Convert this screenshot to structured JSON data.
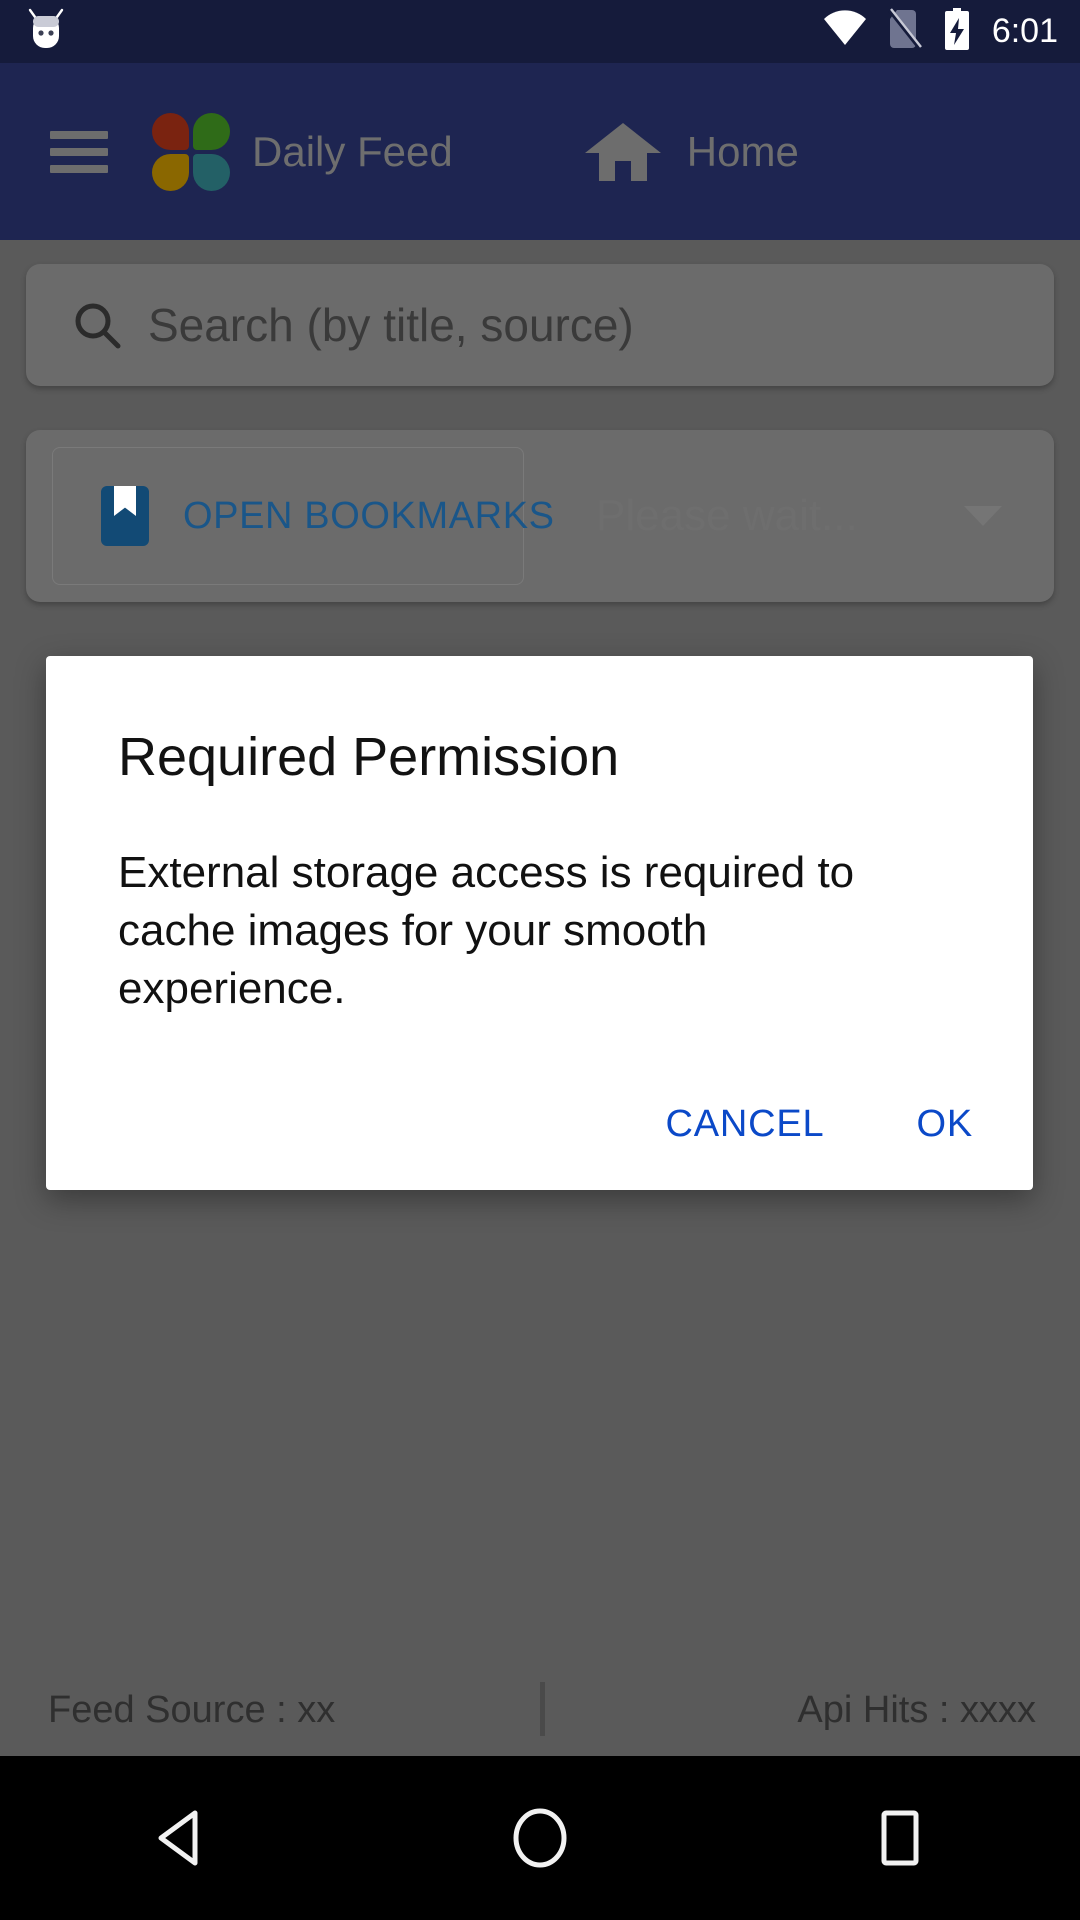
{
  "status_bar": {
    "time": "6:01",
    "icons": [
      "android-head-icon",
      "wifi-icon",
      "no-sim-icon",
      "battery-charging-icon"
    ]
  },
  "app_bar": {
    "menu_icon": "hamburger-menu-icon",
    "logo_icon": "four-petal-logo-icon",
    "title": "Daily Feed",
    "home_icon": "home-icon",
    "home_label": "Home",
    "background_color": "#1e2551"
  },
  "search": {
    "icon": "search-icon",
    "placeholder": "Search (by title, source)",
    "value": ""
  },
  "bookmarks_row": {
    "button_icon": "bookmark-icon",
    "button_label": "OPEN BOOKMARKS",
    "spinner_value": "Please wait...",
    "spinner_caret_icon": "chevron-down-icon"
  },
  "dialog": {
    "title": "Required Permission",
    "message": "External storage access is required to cache images for your smooth experience.",
    "cancel_label": "CANCEL",
    "ok_label": "OK",
    "accent_color": "#0b49c8"
  },
  "footer": {
    "feed_source": "Feed Source : xx",
    "api_hits": "Api Hits : xxxx"
  },
  "nav_bar": {
    "back_icon": "back-triangle-icon",
    "home_icon": "home-circle-icon",
    "recents_icon": "recents-square-icon"
  }
}
